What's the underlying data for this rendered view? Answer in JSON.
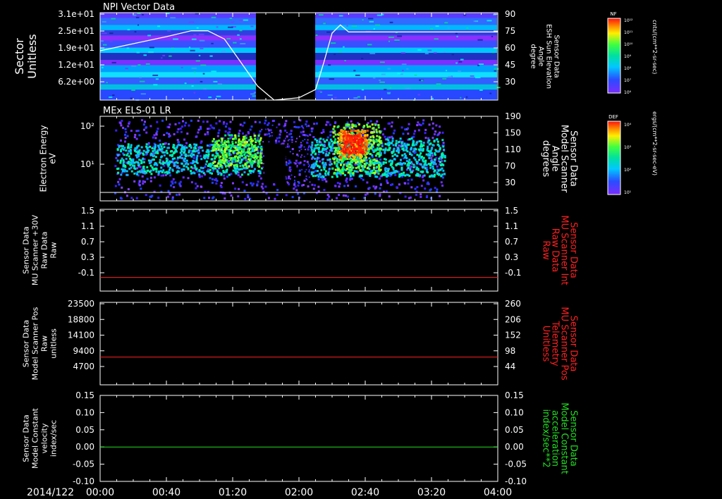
{
  "colors": {
    "background": "#000000",
    "axis": "#ffffff",
    "red_trace": "#ff2020",
    "green_trace": "#22dd22"
  },
  "time_axis": {
    "date_label": "2014/122",
    "ticks": [
      "00:00",
      "00:40",
      "01:20",
      "02:00",
      "02:40",
      "03:20",
      "04:00"
    ]
  },
  "chart_data": [
    {
      "type": "heatmap",
      "title": "NPI Vector Data",
      "ylabel": [
        "Sector",
        "Unitless"
      ],
      "yticks": [
        "3.1e+01",
        "2.5e+01",
        "1.9e+01",
        "1.2e+01",
        "6.2e+00"
      ],
      "right_label": [
        "Sensor Data",
        "ESH Sun Elevation",
        "Angle",
        "degree"
      ],
      "right_ticks": [
        "90",
        "75",
        "60",
        "45",
        "30"
      ],
      "overlay_line": {
        "name": "ESH Sun Elevation Angle",
        "x": [
          "00:00",
          "00:20",
          "00:40",
          "00:55",
          "01:05",
          "01:15",
          "01:25",
          "01:35",
          "01:45",
          "02:00",
          "02:10",
          "02:15",
          "02:20",
          "02:25",
          "02:30",
          "02:40",
          "03:20",
          "04:00"
        ],
        "y": [
          60,
          66,
          72,
          77,
          77,
          70,
          50,
          30,
          18,
          20,
          27,
          50,
          75,
          82,
          76,
          76,
          76,
          76
        ]
      },
      "colorbar": {
        "label": "NF",
        "ticks": [
          "10¹²",
          "10¹¹",
          "10¹⁰",
          "10⁹",
          "10⁸",
          "10⁷",
          "10⁶"
        ],
        "units": "cnts/(cm**2-sr-sec)"
      }
    },
    {
      "type": "heatmap",
      "title": "MEx ELS-01 LR",
      "ylabel": [
        "Electron Energy",
        "eV"
      ],
      "yticks": [
        "10²",
        "10¹"
      ],
      "right_label": [
        "Sensor Data",
        "Model Scanner",
        "Angle",
        "degrees"
      ],
      "right_ticks": [
        "190",
        "150",
        "110",
        "70",
        "30"
      ],
      "overlay_line": {
        "name": "Model Scanner Angle",
        "x": [
          "00:00",
          "04:00"
        ],
        "y": [
          10,
          10
        ]
      },
      "colorbar": {
        "label": "DEF",
        "ticks": [
          "10⁴",
          "10³",
          "10²",
          "10¹"
        ],
        "units": "ergs/(cm**2-sr-sec-eV)"
      }
    },
    {
      "type": "line",
      "ylabel": [
        "Sensor Data",
        "MU Scanner +30V",
        "Raw Data",
        "Raw"
      ],
      "yticks": [
        "1.5",
        "1.1",
        "0.7",
        "0.3",
        "-0.1"
      ],
      "ylim": [
        -0.3,
        1.5
      ],
      "right_label": [
        "Sensor Data",
        "MU Scanner Int",
        "Raw Data",
        "Raw"
      ],
      "right_ticks": [
        "1.5",
        "1.1",
        "0.7",
        "0.3",
        "-0.1"
      ],
      "series": [
        {
          "x": [
            "00:00",
            "04:00"
          ],
          "values": [
            0.0,
            0.0
          ]
        }
      ]
    },
    {
      "type": "line",
      "ylabel": [
        "Sensor Data",
        "Model Scanner Pos",
        "Raw",
        "unitless"
      ],
      "yticks": [
        "23500",
        "18800",
        "14100",
        "9400",
        "4700"
      ],
      "ylim": [
        0,
        23500
      ],
      "right_label": [
        "Sensor Data",
        "MU Scanner Pos",
        "Telemetry",
        "Unitless"
      ],
      "right_ticks": [
        "260",
        "206",
        "152",
        "98",
        "44"
      ],
      "series": [
        {
          "x": [
            "00:00",
            "04:00"
          ],
          "values": [
            7900,
            7900
          ]
        }
      ]
    },
    {
      "type": "line",
      "ylabel": [
        "Sensor Data",
        "Model Constant",
        "velocity",
        "index/sec"
      ],
      "yticks": [
        "0.15",
        "0.10",
        "0.05",
        "0.00",
        "-0.05",
        "-0.10"
      ],
      "ylim": [
        -0.1,
        0.15
      ],
      "right_label": [
        "Sensor Data",
        "Model Constant",
        "acceleration",
        "index/sec**2"
      ],
      "right_ticks": [
        "0.15",
        "0.10",
        "0.05",
        "0.00",
        "-0.05",
        "-0.10"
      ],
      "series": [
        {
          "x": [
            "00:00",
            "04:00"
          ],
          "values": [
            0.0,
            0.0
          ]
        }
      ]
    }
  ]
}
